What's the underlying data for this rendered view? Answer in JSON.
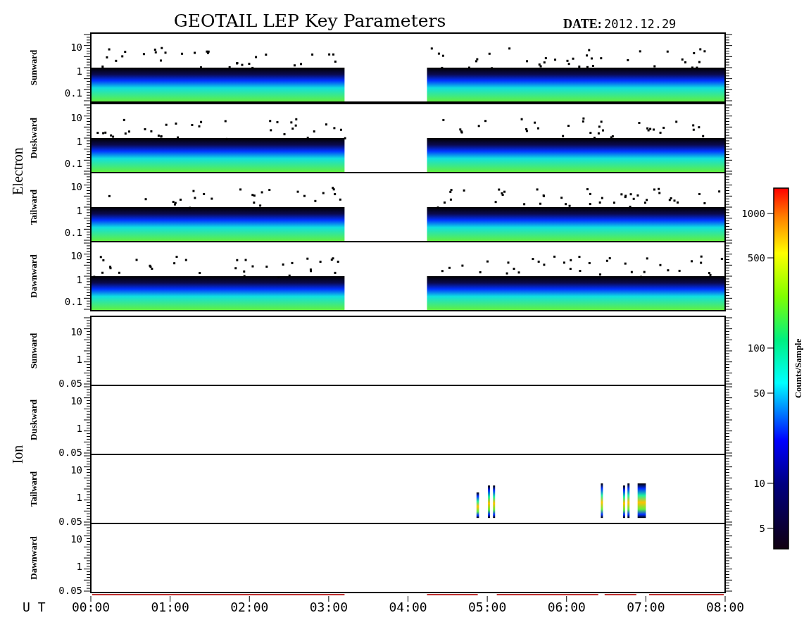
{
  "title": "GEOTAIL LEP Key Parameters",
  "date_label": "DATE:",
  "date": "2012.12.29",
  "groups": [
    {
      "label": "Electron",
      "panels": [
        {
          "label": "Sunward",
          "kind": "band",
          "yticks": [
            "10",
            "1",
            "0.1"
          ]
        },
        {
          "label": "Duskward",
          "kind": "band",
          "yticks": [
            "10",
            "1",
            "0.1"
          ]
        },
        {
          "label": "Tailward",
          "kind": "band",
          "yticks": [
            "10",
            "1",
            "0.1"
          ]
        },
        {
          "label": "Dawnward",
          "kind": "band",
          "yticks": [
            "10",
            "1",
            "0.1"
          ]
        }
      ]
    },
    {
      "label": "Ion",
      "panels": [
        {
          "label": "Sunward",
          "kind": "empty",
          "yticks": [
            "10",
            "1",
            "0.05"
          ]
        },
        {
          "label": "Duskward",
          "kind": "empty",
          "yticks": [
            "10",
            "1",
            "0.05"
          ]
        },
        {
          "label": "Tailward",
          "kind": "bursts",
          "yticks": [
            "10",
            "1",
            "0.05"
          ]
        },
        {
          "label": "Dawnward",
          "kind": "empty",
          "yticks": [
            "10",
            "1",
            "0.05"
          ]
        }
      ]
    }
  ],
  "colorbar": {
    "label": "Counts/Sample",
    "ticks": [
      "1000",
      "500",
      "100",
      "50",
      "10",
      "5"
    ]
  },
  "xaxis": {
    "label": "U T",
    "ticks": [
      "00:00",
      "01:00",
      "02:00",
      "03:00",
      "04:00",
      "05:00",
      "06:00",
      "07:00",
      "08:00"
    ]
  }
}
